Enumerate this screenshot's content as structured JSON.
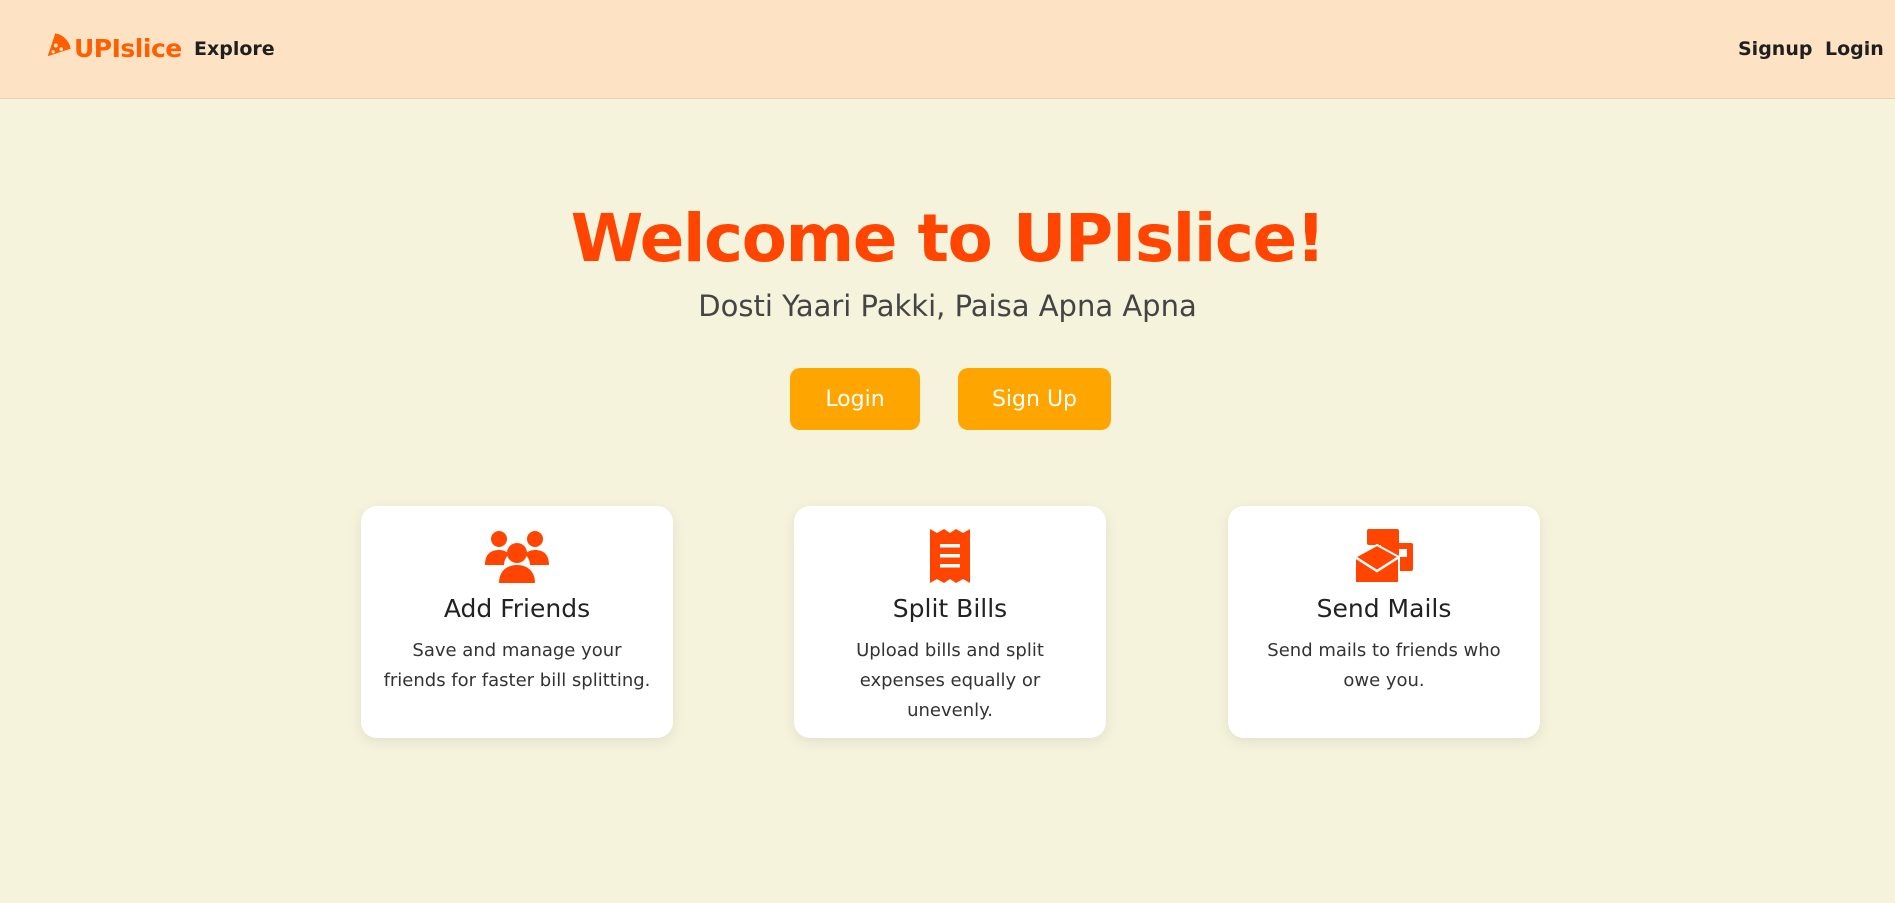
{
  "header": {
    "brand": "UPIslice",
    "explore": "Explore",
    "signup": "Signup",
    "login": "Login"
  },
  "hero": {
    "title": "Welcome to UPIslice!",
    "subtitle": "Dosti Yaari Pakki, Paisa Apna Apna",
    "login_label": "Login",
    "signup_label": "Sign Up"
  },
  "features": [
    {
      "icon": "users-icon",
      "title": "Add Friends",
      "description": "Save and manage your friends for faster bill splitting."
    },
    {
      "icon": "receipt-icon",
      "title": "Split Bills",
      "description": "Upload bills and split expenses equally or unevenly."
    },
    {
      "icon": "mail-bulk-icon",
      "title": "Send Mails",
      "description": "Send mails to friends who owe you."
    }
  ],
  "colors": {
    "header_bg": "#fde3c4",
    "page_bg": "#f5f3dc",
    "accent": "#ff4500",
    "button": "#ffa500"
  }
}
